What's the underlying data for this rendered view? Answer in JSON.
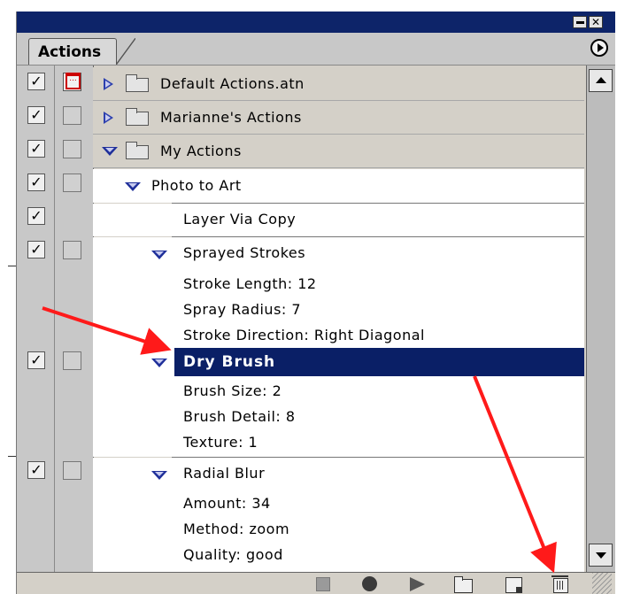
{
  "palette": {
    "title_bar": "#0d2469",
    "selection": "#0a1f66",
    "panel_gray": "#d4d0c8",
    "annotation_arrow": "#ff1a1a"
  },
  "window": {
    "title_buttons": [
      "minimize-icon",
      "close-icon"
    ],
    "close_glyph": "✕"
  },
  "tab": {
    "label": "Actions",
    "menu_icon": "play-circle-icon"
  },
  "rows": [
    {
      "label": "Default Actions.atn",
      "type": "set",
      "expanded": false,
      "checked": true,
      "dialog": true
    },
    {
      "label": "Marianne's Actions",
      "type": "set",
      "expanded": false,
      "checked": true,
      "dialog": false
    },
    {
      "label": "My Actions",
      "type": "set",
      "expanded": true,
      "checked": true,
      "dialog": false
    },
    {
      "label": "Photo to Art",
      "type": "action",
      "expanded": true,
      "checked": true,
      "dialog": false
    },
    {
      "label": "Layer Via Copy",
      "type": "command",
      "checked": true
    },
    {
      "label": "Sprayed Strokes",
      "type": "command",
      "expanded": true,
      "checked": true,
      "dialog": false
    },
    {
      "label": "Stroke Length: 12",
      "type": "parameter"
    },
    {
      "label": "Spray Radius: 7",
      "type": "parameter"
    },
    {
      "label": "Stroke Direction: Right Diagonal",
      "type": "parameter"
    },
    {
      "label": "Dry Brush",
      "type": "command",
      "expanded": true,
      "selected": true,
      "checked": true,
      "dialog": false
    },
    {
      "label": "Brush Size: 2",
      "type": "parameter"
    },
    {
      "label": "Brush Detail: 8",
      "type": "parameter"
    },
    {
      "label": "Texture: 1",
      "type": "parameter"
    },
    {
      "label": "Radial Blur",
      "type": "command",
      "expanded": true,
      "checked": true,
      "dialog": false
    },
    {
      "label": "Amount: 34",
      "type": "parameter"
    },
    {
      "label": "Method: zoom",
      "type": "parameter"
    },
    {
      "label": "Quality: good",
      "type": "parameter"
    }
  ],
  "checkmark": "✓",
  "bottom_toolbar": [
    "stop-icon",
    "record-icon",
    "play-icon",
    "new-set-icon",
    "new-action-icon",
    "trash-icon"
  ]
}
